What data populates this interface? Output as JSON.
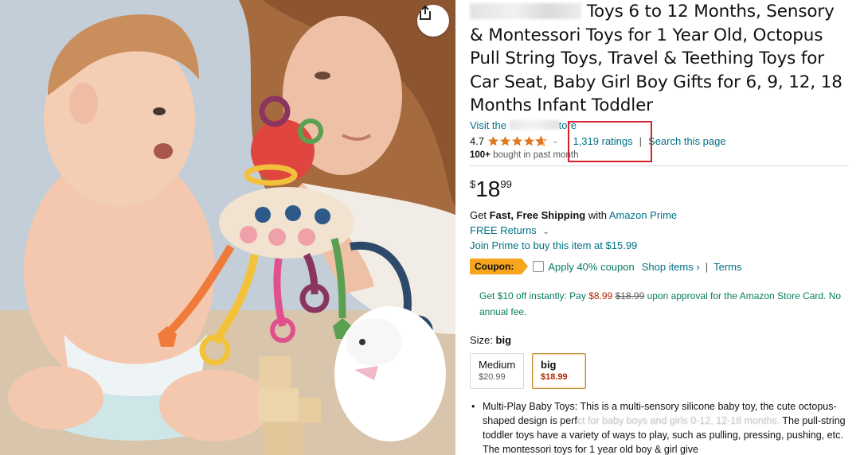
{
  "product": {
    "title_rest": "Toys 6 to 12 Months, Sensory & Montessori Toys for 1 Year Old, Octopus Pull String Toys, Travel & Teething Toys for Car Seat, Baby Girl Boy Gifts for 6, 9, 12, 18 Months Infant Toddler",
    "visit_prefix": "Visit the",
    "visit_suffix": "tore",
    "rating_value": "4.7",
    "rating_stars": 4.7,
    "ratings_count": "1,319 ratings",
    "separator": "|",
    "search_page": "Search this page",
    "bought_bold": "100+",
    "bought_rest": "bought in past month"
  },
  "price": {
    "symbol": "$",
    "whole": "18",
    "fraction": "99"
  },
  "shipping": {
    "get": "Get",
    "fast_free": "Fast, Free Shipping",
    "with": "with",
    "prime": "Amazon Prime",
    "returns": "FREE Returns",
    "join_prime": "Join Prime to buy this item at $15.99"
  },
  "coupon": {
    "badge": "Coupon:",
    "apply": "Apply 40% coupon",
    "shop_items": "Shop items ›",
    "separator": "|",
    "terms": "Terms"
  },
  "card_offer": {
    "prefix": "Get $10 off instantly: Pay",
    "new_price": "$8.99",
    "old_price": "$18.99",
    "suffix": "upon approval for the Amazon Store Card. No annual fee."
  },
  "size": {
    "label": "Size:",
    "selected": "big",
    "options": [
      {
        "name": "Medium",
        "price": "$20.99"
      },
      {
        "name": "big",
        "price": "$18.99"
      }
    ]
  },
  "bullets": {
    "b1_start": "Multi-Play Baby Toys: This is a multi-sensory silicone baby toy, the cute octopus-shaped design is perf",
    "b1_blur": "ct for baby boys and girls 0-12, 12-18 months.",
    "b1_cont": "The pull-string toddler toys have a variety of ways to play, such as pulling, pressing, pushing, etc. The montessori toys for 1 year old boy & girl give"
  },
  "colors": {
    "link": "#007185",
    "price_red": "#b12704",
    "coupon_green": "#067d62",
    "coupon_badge": "#f7a51c",
    "star": "#de7921",
    "highlight": "#d8202a"
  }
}
